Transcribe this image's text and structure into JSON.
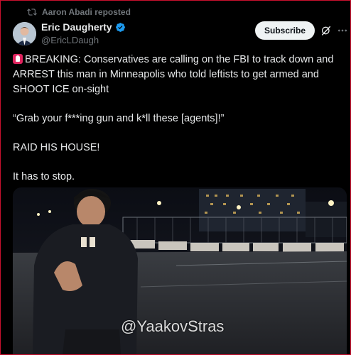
{
  "repost": {
    "text": "Aaron Abadi reposted"
  },
  "author": {
    "name": "Eric Daugherty",
    "handle": "@EricLDaugh"
  },
  "actions": {
    "subscribe_label": "Subscribe"
  },
  "tweet": {
    "line1": "BREAKING: Conservatives are calling on the FBI to track down and ARREST this man in Minneapolis who told leftists to get armed and SHOOT ICE on-sight",
    "line2": "“Grab your f***ing gun and k*ll these [agents]!”",
    "line3": "RAID HIS HOUSE!",
    "line4": "It has to stop."
  },
  "media": {
    "watermark": "@YaakovStras"
  },
  "icons": {
    "repost": "repost-icon",
    "verified": "verified-badge-icon",
    "grok": "grok-icon",
    "more": "more-icon",
    "siren": "rotating-light-icon"
  },
  "colors": {
    "verified": "#1d9bf0",
    "muted": "#71767b",
    "background": "#000000"
  }
}
